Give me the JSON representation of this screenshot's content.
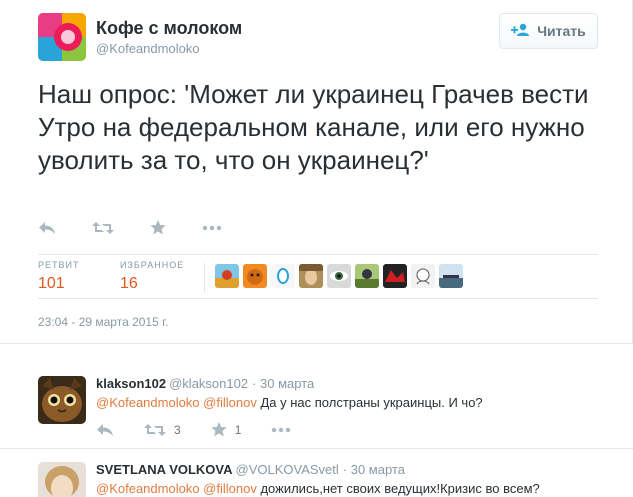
{
  "account": {
    "name": "Кофе с молоком",
    "handle": "@Kofeandmoloko",
    "follow_label": "Читать"
  },
  "tweet": {
    "text": "Наш опрос: 'Может ли украинец Грачев вести Утро на федеральном канале, или его нужно уволить за то, что он украинец?'",
    "retweets_label": "РЕТВИТ",
    "retweets": "101",
    "favorites_label": "ИЗБРАННОЕ",
    "favorites": "16",
    "timestamp": "23:04 - 29 марта 2015 г."
  },
  "replies": [
    {
      "name": "klakson102",
      "handle": "@klakson102",
      "date": "· 30 марта",
      "mention1": "@Kofeandmoloko",
      "mention2": "@fillonov",
      "text": "Да у нас полстраны украинцы. И чо?",
      "retweets": "3",
      "favorites": "1"
    },
    {
      "name": "SVETLANA VOLKOVA",
      "handle": "@VOLKOVASvetl",
      "date": "· 30 марта",
      "mention1": "@Kofeandmoloko",
      "mention2": "@fillonov",
      "text": "дожились,нет своих ведущих!Кризис во всем?"
    }
  ],
  "colors": {
    "accent": "#e05a1f",
    "mention": "#e07b3f",
    "muted": "#8899a6"
  }
}
